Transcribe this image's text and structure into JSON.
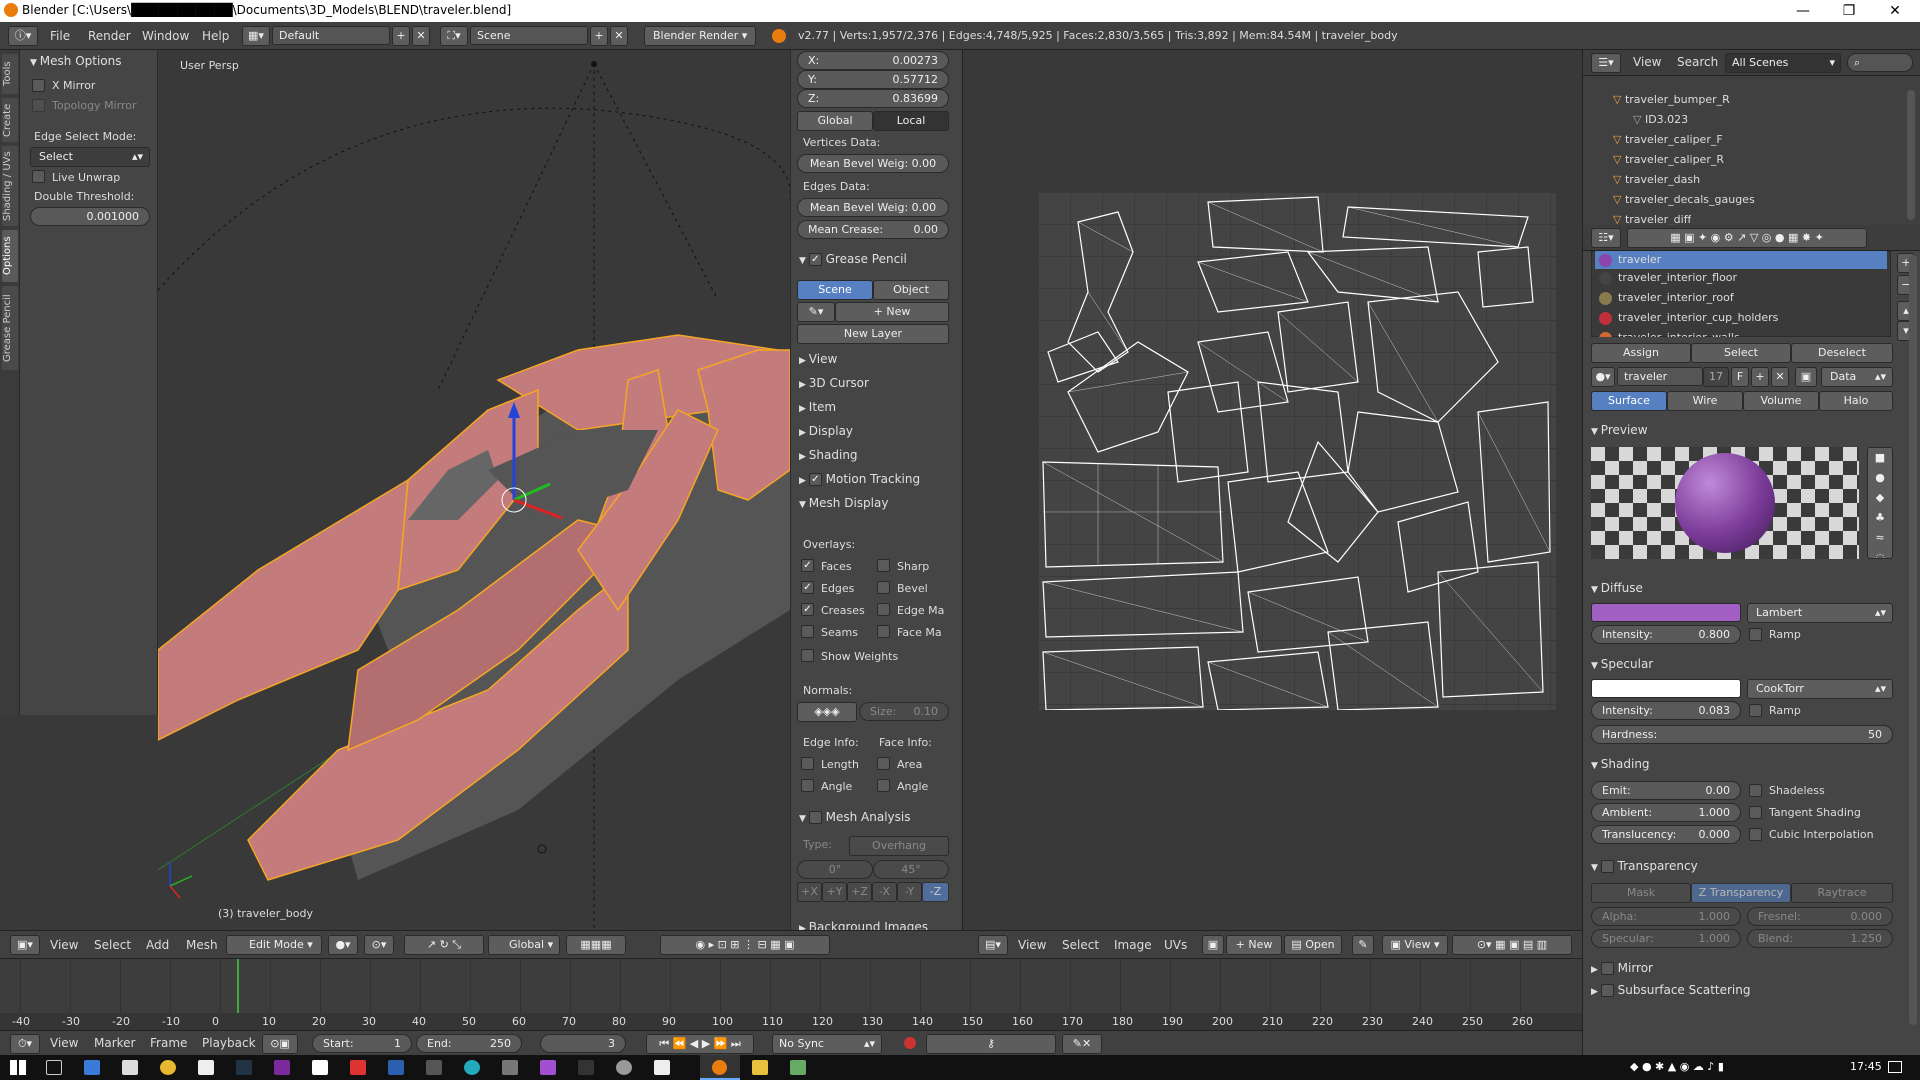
{
  "window": {
    "title": "Blender [C:\\Users\\███████████\\Documents\\3D_Models\\BLEND\\traveler.blend]",
    "minimize": "—",
    "maximize": "❐",
    "close": "✕"
  },
  "info": {
    "menus": [
      "File",
      "Render",
      "Window",
      "Help"
    ],
    "layout": "Default",
    "scene": "Scene",
    "engine": "Blender Render",
    "stats": "v2.77 | Verts:1,957/2,376 | Edges:4,748/5,925 | Faces:2,830/3,565 | Tris:3,892 | Mem:84.54M | traveler_body"
  },
  "tabs": [
    "Tools",
    "Create",
    "Shading / UVs",
    "Options",
    "Grease Pencil"
  ],
  "toolshelf": {
    "title": "Mesh Options",
    "x_mirror": "X Mirror",
    "topology_mirror": "Topology Mirror",
    "edge_select_mode": "Edge Select Mode:",
    "select": "Select",
    "live_unwrap": "Live Unwrap",
    "double_threshold": "Double Threshold:",
    "double_value": "0.001000"
  },
  "viewport": {
    "label": "User Persp",
    "object": "(3) traveler_body",
    "colors": {
      "wire": "#f5a623",
      "face": "#c47b7b",
      "inner": "#5a5a5a"
    }
  },
  "npanel": {
    "x": "X:",
    "x_val": "0.00273",
    "y": "Y:",
    "y_val": "0.57712",
    "z": "Z:",
    "z_val": "0.83699",
    "global": "Global",
    "local": "Local",
    "vertices_data": "Vertices Data:",
    "mean_bevel_v": "Mean Bevel Weig: 0.00",
    "edges_data": "Edges Data:",
    "mean_bevel_e": "Mean Bevel Weig: 0.00",
    "mean_crease": "Mean Crease:",
    "mean_crease_val": "0.00",
    "grease_pencil": "Grease Pencil",
    "scene": "Scene",
    "object": "Object",
    "new": "New",
    "new_layer": "New Layer",
    "view": "View",
    "cursor": "3D Cursor",
    "item": "Item",
    "display": "Display",
    "shading": "Shading",
    "motion_tracking": "Motion Tracking",
    "mesh_display": "Mesh Display",
    "overlays": "Overlays:",
    "faces": "Faces",
    "sharp": "Sharp",
    "edges": "Edges",
    "bevel": "Bevel",
    "creases": "Creases",
    "edge_ma": "Edge Ma",
    "seams": "Seams",
    "face_ma": "Face Ma",
    "show_weights": "Show Weights",
    "normals": "Normals:",
    "size": "Size:",
    "size_val": "0.10",
    "edge_info": "Edge Info:",
    "face_info": "Face Info:",
    "length": "Length",
    "area": "Area",
    "angle_e": "Angle",
    "angle_f": "Angle",
    "mesh_analysis": "Mesh Analysis",
    "type": "Type:",
    "type_val": "Overhang",
    "deg0": "0°",
    "deg45": "45°",
    "axes": [
      "+X",
      "+Y",
      "+Z",
      "-X",
      "-Y",
      "-Z"
    ],
    "background_images": "Background Images"
  },
  "vheader": {
    "menus": [
      "View",
      "Select",
      "Add",
      "Mesh"
    ],
    "mode": "Edit Mode",
    "orientation": "Global"
  },
  "uvheader": {
    "menus": [
      "View",
      "Select",
      "Image",
      "UVs"
    ],
    "new": "New",
    "open": "Open",
    "view": "View"
  },
  "outliner": {
    "menus": [
      "View",
      "Search"
    ],
    "filter": "All Scenes",
    "items": [
      "traveler_bumper_R",
      "ID3.023",
      "traveler_caliper_F",
      "traveler_caliper_R",
      "traveler_dash",
      "traveler_decals_gauges",
      "traveler_diff"
    ]
  },
  "props": {
    "materials": [
      {
        "name": "traveler",
        "color": "#8e44ad"
      },
      {
        "name": "traveler_interior_floor",
        "color": "#444444"
      },
      {
        "name": "traveler_interior_roof",
        "color": "#8a7a50"
      },
      {
        "name": "traveler_interior_cup_holders",
        "color": "#c0303a"
      },
      {
        "name": "traveler_interior_walls",
        "color": "#d06a30"
      }
    ],
    "assign": "Assign",
    "select": "Select",
    "deselect": "Deselect",
    "mat_name": "traveler",
    "users": "17",
    "fake": "F",
    "data": "Data",
    "surface": "Surface",
    "wire": "Wire",
    "volume": "Volume",
    "halo": "Halo",
    "preview": "Preview",
    "diffuse": "Diffuse",
    "diffuse_color": "#a25fc4",
    "lambert": "Lambert",
    "intensity": "Intensity:",
    "diffuse_int": "0.800",
    "ramp": "Ramp",
    "specular": "Specular",
    "cooktorr": "CookTorr",
    "spec_int": "0.083",
    "hardness": "Hardness:",
    "hardness_val": "50",
    "shading": "Shading",
    "emit": "Emit:",
    "emit_val": "0.00",
    "shadeless": "Shadeless",
    "ambient": "Ambient:",
    "ambient_val": "1.000",
    "tangent": "Tangent Shading",
    "translucency": "Translucency:",
    "transl_val": "0.000",
    "cubic": "Cubic Interpolation",
    "transparency": "Transparency",
    "mask": "Mask",
    "ztrans": "Z Transparency",
    "raytrace": "Raytrace",
    "alpha": "Alpha:",
    "alpha_val": "1.000",
    "fresnel": "Fresnel:",
    "fresnel_val": "0.000",
    "specular_l": "Specular:",
    "specular_val": "1.000",
    "blend": "Blend:",
    "blend_val": "1.250",
    "mirror": "Mirror",
    "sss": "Subsurface Scattering"
  },
  "timeline": {
    "ticks": [
      "-40",
      "-30",
      "-20",
      "-10",
      "0",
      "10",
      "20",
      "30",
      "40",
      "50",
      "60",
      "70",
      "80",
      "90",
      "100",
      "110",
      "120",
      "130",
      "140",
      "150",
      "160",
      "170",
      "180",
      "190",
      "200",
      "210",
      "220",
      "230",
      "240",
      "250",
      "260"
    ],
    "menus": [
      "View",
      "Marker",
      "Frame",
      "Playback"
    ],
    "start": "Start:",
    "start_val": "1",
    "end": "End:",
    "end_val": "250",
    "current": "3",
    "sync": "No Sync"
  },
  "taskbar": {
    "time": "17:45"
  }
}
